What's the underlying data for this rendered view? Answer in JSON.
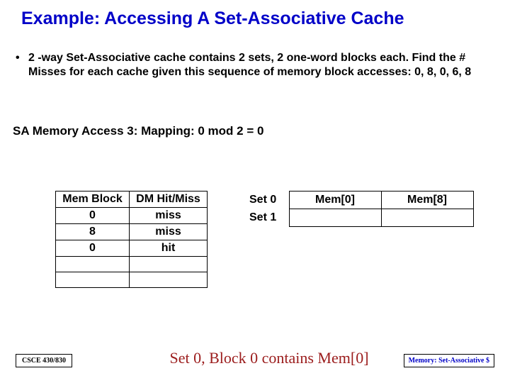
{
  "title": "Example: Accessing A Set-Associative Cache",
  "bullet": "2 -way Set-Associative cache contains 2 sets, 2 one-word blocks each. Find the # Misses for each cache given this sequence of memory block accesses: 0, 8, 0, 6, 8",
  "access_line": "SA Memory Access 3:  Mapping: 0 mod 2 = 0",
  "table1": {
    "h1": "Mem Block",
    "h2": "DM Hit/Miss",
    "rows": [
      {
        "a": "0",
        "b": "miss"
      },
      {
        "a": "8",
        "b": "miss"
      },
      {
        "a": "0",
        "b": "hit"
      }
    ]
  },
  "table2": {
    "r0_label": "Set 0",
    "r0_c1": "Mem[0]",
    "r0_c2": "Mem[8]",
    "r1_label": "Set 1",
    "r1_c1": "",
    "r1_c2": ""
  },
  "caption": "Set 0, Block 0 contains Mem[0]",
  "course": "CSCE 430/830",
  "foot_right": "Memory: Set-Associative $"
}
